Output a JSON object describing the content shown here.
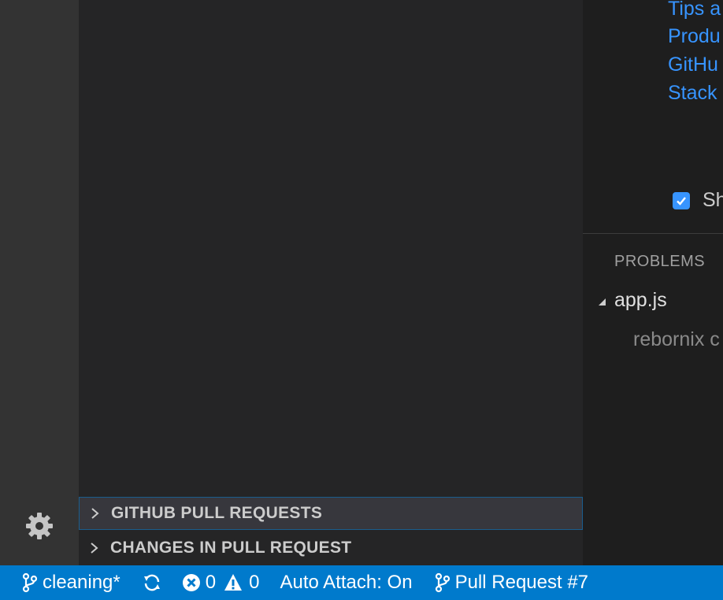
{
  "editor": {
    "links": [
      "Tips a",
      "Produ",
      "GitHu",
      "Stack"
    ],
    "show_label": "Sh"
  },
  "sidebar": {
    "sections": [
      {
        "label": "GITHUB PULL REQUESTS",
        "focused": true
      },
      {
        "label": "CHANGES IN PULL REQUEST",
        "focused": false
      }
    ]
  },
  "panel": {
    "tab": "PROBLEMS",
    "file": "app.js",
    "item": "rebornix c"
  },
  "statusbar": {
    "branch": "cleaning*",
    "errors": "0",
    "warnings": "0",
    "auto_attach": "Auto Attach: On",
    "pull_request": "Pull Request #7"
  },
  "colors": {
    "accent": "#007acc",
    "link": "#3794ff",
    "activity_bar": "#333333",
    "sidebar": "#252526",
    "editor": "#1e1e1e"
  },
  "icons": [
    "gear-icon",
    "checkbox-check-icon",
    "chevron-right-icon",
    "triangle-down-icon",
    "git-branch-icon",
    "sync-icon",
    "error-icon",
    "warning-icon",
    "git-pull-request-icon"
  ]
}
